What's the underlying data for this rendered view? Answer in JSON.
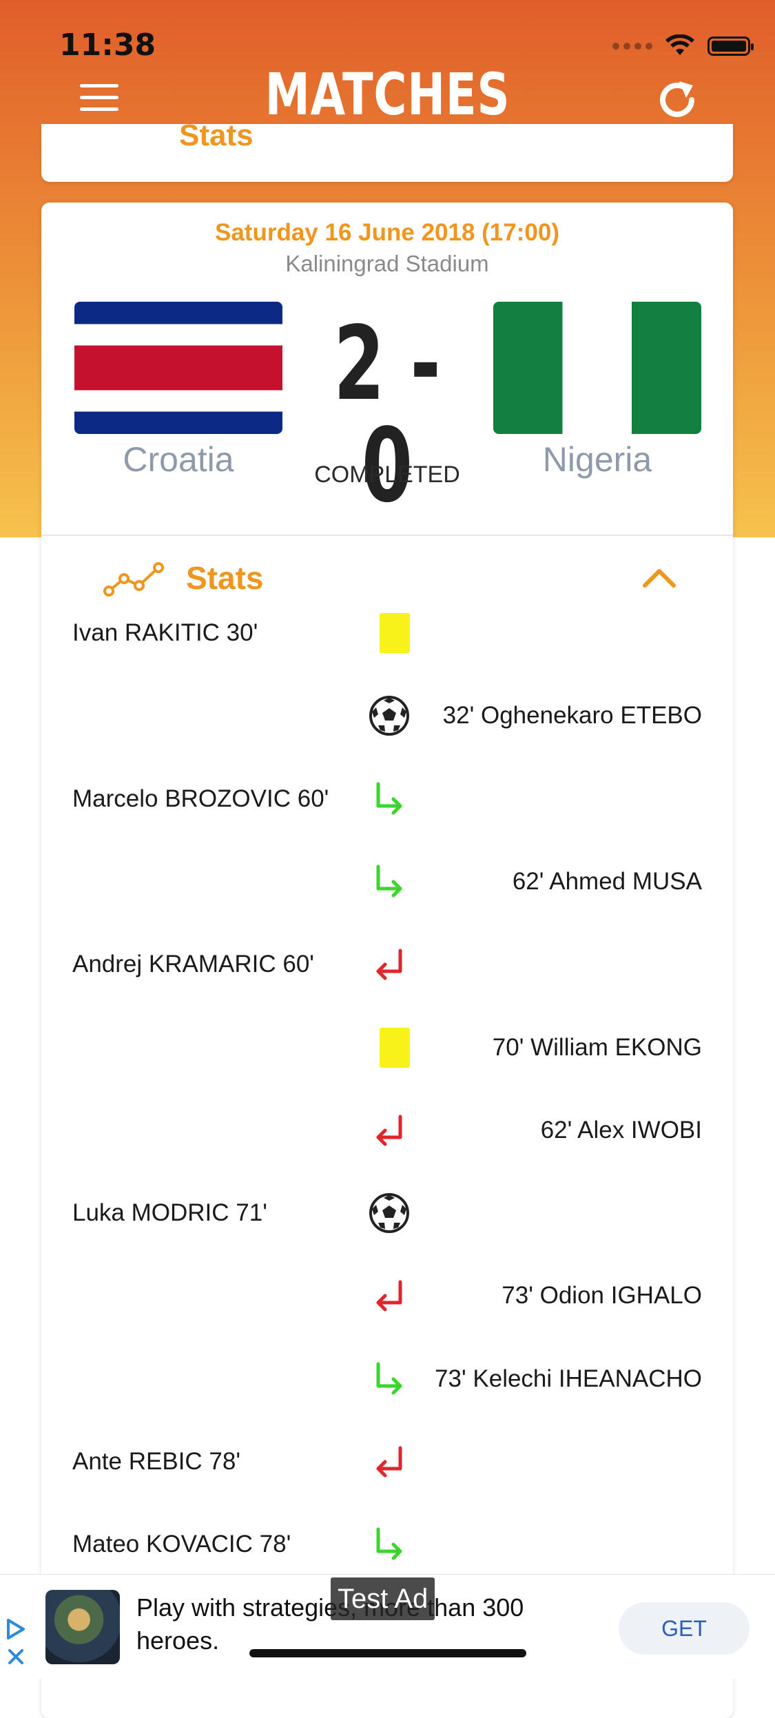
{
  "status_bar": {
    "time": "11:38"
  },
  "nav": {
    "title": "MATCHES"
  },
  "previous_card": {
    "stats_label": "Stats"
  },
  "match": {
    "date": "Saturday 16 June 2018 (17:00)",
    "venue": "Kaliningrad Stadium",
    "home_team": "Croatia",
    "away_team": "Nigeria",
    "score": "2 - 0",
    "status": "COMPLETED"
  },
  "stats": {
    "label": "Stats",
    "events": [
      {
        "home": "Ivan RAKITIC 30'",
        "away": "",
        "icon": "yellow-card"
      },
      {
        "home": "",
        "away": "32' Oghenekaro ETEBO",
        "icon": "soccer-ball"
      },
      {
        "home": "Marcelo BROZOVIC 60'",
        "away": "",
        "icon": "sub-in-arrow"
      },
      {
        "home": "",
        "away": "62' Ahmed MUSA",
        "icon": "sub-in-arrow"
      },
      {
        "home": "Andrej KRAMARIC 60'",
        "away": "",
        "icon": "sub-out-arrow"
      },
      {
        "home": "",
        "away": "70' William EKONG",
        "icon": "yellow-card"
      },
      {
        "home": "",
        "away": "62' Alex IWOBI",
        "icon": "sub-out-arrow"
      },
      {
        "home": "Luka MODRIC 71'",
        "away": "",
        "icon": "soccer-ball"
      },
      {
        "home": "",
        "away": "73' Odion IGHALO",
        "icon": "sub-out-arrow"
      },
      {
        "home": "",
        "away": "73' Kelechi IHEANACHO",
        "icon": "sub-in-arrow"
      },
      {
        "home": "Ante REBIC 78'",
        "away": "",
        "icon": "sub-out-arrow"
      },
      {
        "home": "Mateo KOVACIC 78'",
        "away": "",
        "icon": "sub-in-arrow"
      }
    ]
  },
  "ad": {
    "text": "Play with strategies, more than 300 heroes.",
    "label": "Test Ad",
    "cta": "GET"
  },
  "colors": {
    "accent": "#f0951e",
    "header_top": "#e05e2a",
    "header_bottom": "#f6c24c",
    "sub_in": "#3bd62c",
    "sub_out": "#e0262b",
    "yellow_card": "#f9f21a"
  }
}
